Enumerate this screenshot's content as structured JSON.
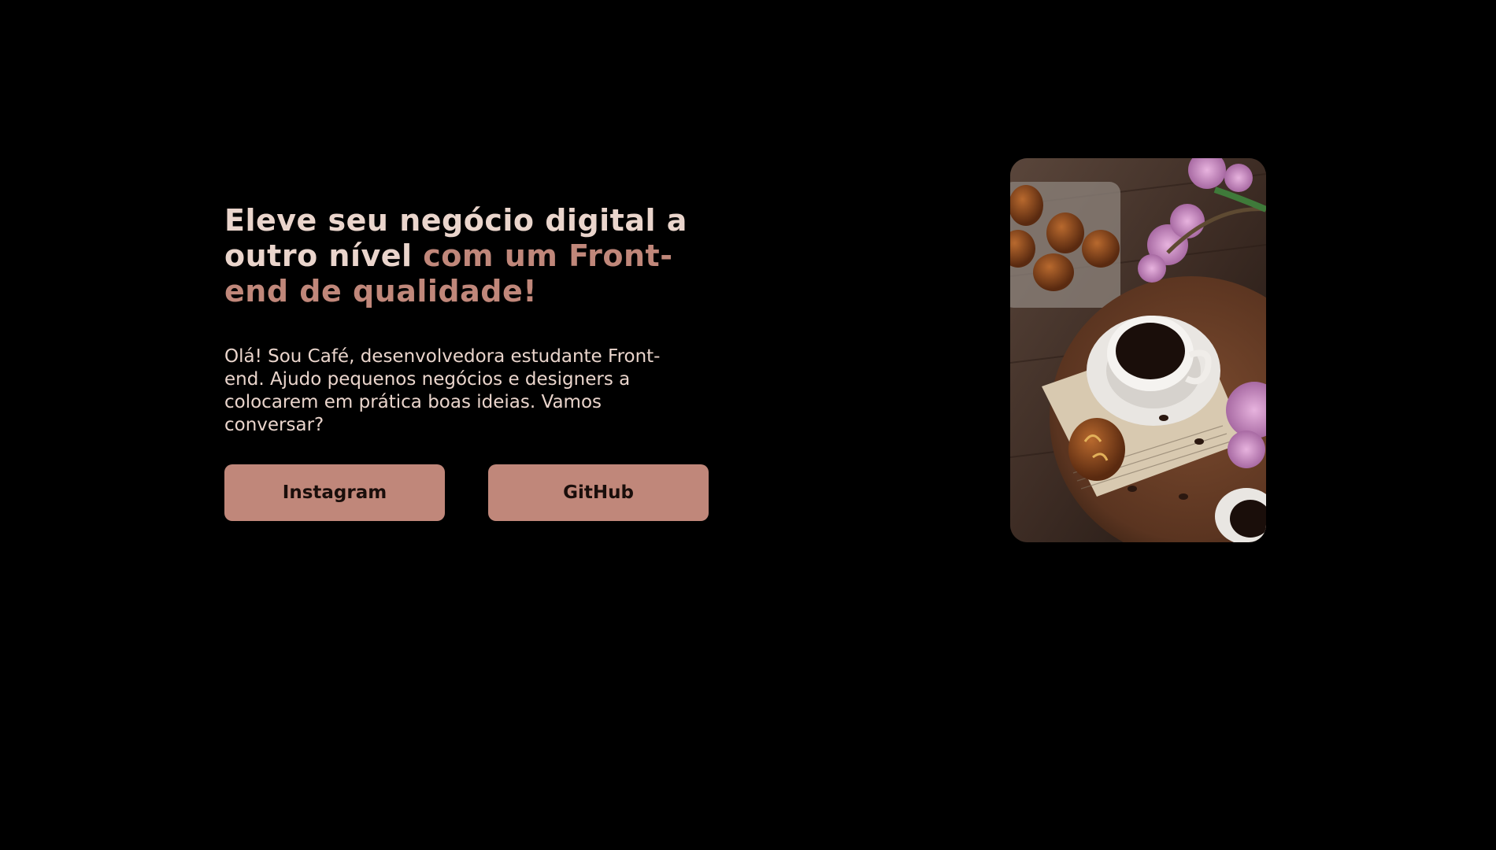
{
  "hero": {
    "headline_part1": "Eleve seu negócio digital a outro nível ",
    "headline_part2": "com um Front-end de qualidade!",
    "intro": "Olá! Sou Café, desenvolvedora estudante Front-end. Ajudo pequenos negócios e designers a colocarem em prática boas ideias. Vamos conversar?"
  },
  "buttons": {
    "instagram_label": "Instagram",
    "github_label": "GitHub"
  },
  "image": {
    "alt": "coffee-cup-photo"
  },
  "colors": {
    "background": "#000000",
    "text_light": "#ead5cc",
    "accent": "#c0877a",
    "button_text": "#1a0e0b"
  }
}
